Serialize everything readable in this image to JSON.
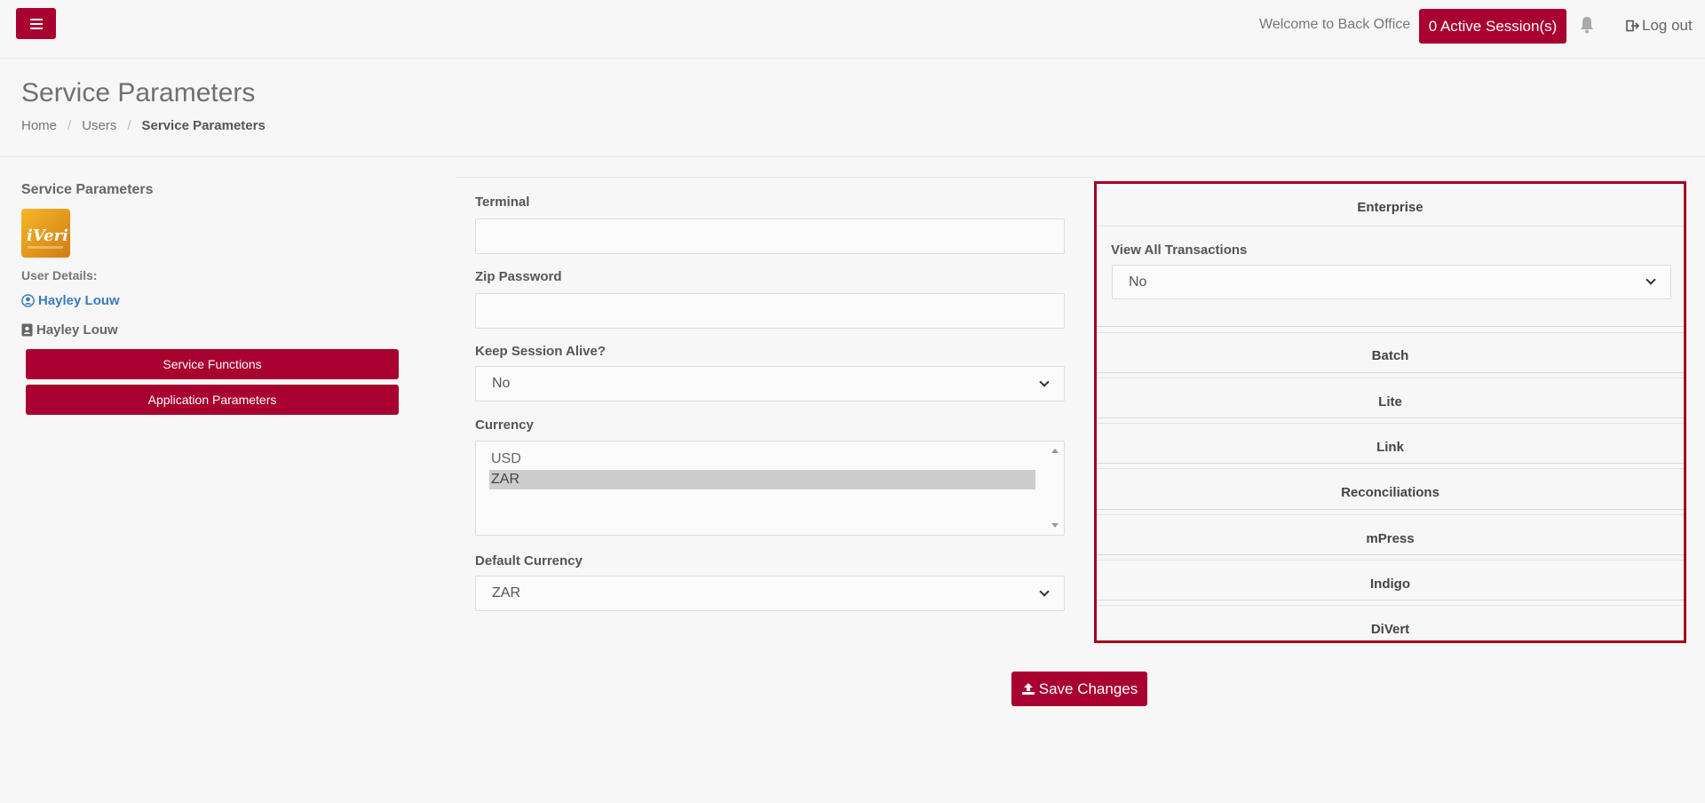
{
  "topbar": {
    "welcome": "Welcome to Back Office",
    "sessions": "0 Active Session(s)",
    "logout": "Log out"
  },
  "header": {
    "title": "Service Parameters",
    "breadcrumb": [
      "Home",
      "Users",
      "Service Parameters"
    ]
  },
  "left": {
    "title": "Service Parameters",
    "user_details_label": "User Details:",
    "user_link": "Hayley Louw",
    "user_name": "Hayley Louw",
    "buttons": [
      "Service Functions",
      "Application Parameters"
    ]
  },
  "form": {
    "terminal_label": "Terminal",
    "terminal_value": "",
    "zip_label": "Zip Password",
    "zip_value": "",
    "keep_alive_label": "Keep Session Alive?",
    "keep_alive_value": "No",
    "currency_label": "Currency",
    "currency_options": [
      "USD",
      "ZAR"
    ],
    "currency_selected": "ZAR",
    "default_currency_label": "Default Currency",
    "default_currency_value": "ZAR"
  },
  "accordion": {
    "enterprise": "Enterprise",
    "view_all_label": "View All Transactions",
    "view_all_value": "No",
    "sections": [
      "Batch",
      "Lite",
      "Link",
      "Reconciliations",
      "mPress",
      "Indigo",
      "DiVert"
    ]
  },
  "save_label": "Save Changes",
  "colors": {
    "accent": "#a8002f",
    "highlight_border": "#a50021",
    "link": "#3b7bbf"
  }
}
